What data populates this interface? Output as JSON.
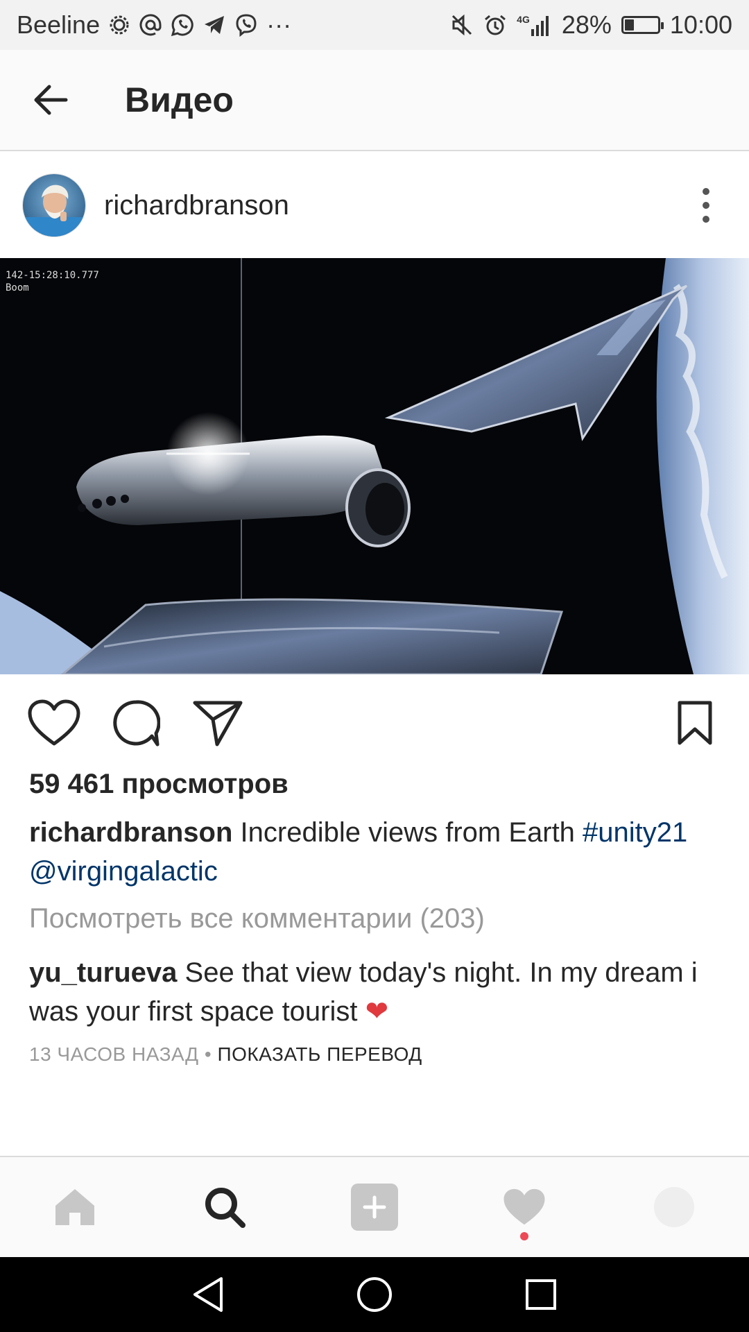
{
  "status_bar": {
    "carrier": "Beeline",
    "network": "4G",
    "battery": "28%",
    "battery_level": 0.28,
    "time": "10:00",
    "overflow": "···"
  },
  "app_bar": {
    "title": "Видео"
  },
  "post": {
    "username": "richardbranson",
    "video_overlay_line1": "142-15:28:10.777",
    "video_overlay_line2": "Boom",
    "views": "59 461 просмотров",
    "caption_user": "richardbranson",
    "caption_text": " Incredible views from Earth ",
    "caption_hashtag": "#unity21",
    "caption_mention": "@virgingalactic",
    "view_all_comments": "Посмотреть все комментарии (203)",
    "comment_user": "yu_turueva",
    "comment_text": " See that view today's night. In my dream i was your first space tourist ",
    "comment_emoji": "❤",
    "time_ago": "13 ЧАСОВ НАЗАД",
    "separator": " • ",
    "show_translation": "ПОКАЗАТЬ ПЕРЕВОД"
  },
  "colors": {
    "link": "#003569",
    "muted": "#999999",
    "heart": "#e0393e",
    "notification_dot": "#ed4956"
  }
}
